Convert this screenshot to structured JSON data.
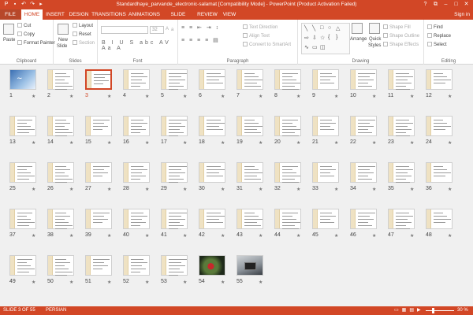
{
  "window": {
    "title": "Standardhaye_parvande_electronic-salamat [Compatibility Mode] - PowerPoint (Product Activation Failed)",
    "qat_icons": [
      "powerpoint-icon",
      "save-icon",
      "undo-icon",
      "redo-icon",
      "present-icon"
    ],
    "controls": {
      "help": "?",
      "restore": "⧉",
      "minimize": "–",
      "maximize": "□",
      "close": "✕"
    }
  },
  "tabs": {
    "file": "FILE",
    "home": "HOME",
    "insert": "INSERT",
    "design": "DESIGN",
    "transitions": "TRANSITIONS",
    "animations": "ANIMATIONS",
    "slideshow": "SLIDE SHOW",
    "review": "REVIEW",
    "view": "VIEW",
    "signin": "Sign in"
  },
  "ribbon": {
    "clipboard": {
      "paste": "Paste",
      "cut": "Cut",
      "copy": "Copy",
      "format_painter": "Format Painter",
      "label": "Clipboard"
    },
    "slides": {
      "new_slide": "New",
      "new_slide2": "Slide",
      "layout": "Layout",
      "reset": "Reset",
      "section": "Section",
      "label": "Slides"
    },
    "font": {
      "name_value": "",
      "size_value": "32",
      "format_buttons": "B I U S abc AV Aa A",
      "label": "Font"
    },
    "paragraph": {
      "text_direction": "Text Direction",
      "align_text": "Align Text",
      "convert_smartart": "Convert to SmartArt",
      "label": "Paragraph"
    },
    "drawing": {
      "arrange": "Arrange",
      "quick": "Quick",
      "styles": "Styles",
      "shape_fill": "Shape Fill",
      "shape_outline": "Shape Outline",
      "shape_effects": "Shape Effects",
      "label": "Drawing"
    },
    "editing": {
      "find": "Find",
      "replace": "Replace",
      "select": "Select",
      "label": "Editing"
    }
  },
  "slides": {
    "selected": 3,
    "numbers": [
      "1",
      "2",
      "3",
      "4",
      "5",
      "6",
      "7",
      "8",
      "9",
      "10",
      "11",
      "12",
      "13",
      "14",
      "15",
      "16",
      "17",
      "18",
      "19",
      "20",
      "21",
      "22",
      "23",
      "24",
      "25",
      "26",
      "27",
      "28",
      "29",
      "30",
      "31",
      "32",
      "33",
      "34",
      "35",
      "36",
      "37",
      "38",
      "39",
      "40",
      "41",
      "42",
      "43",
      "44",
      "45",
      "46",
      "47",
      "48",
      "49",
      "50",
      "51",
      "52",
      "53",
      "54",
      "55"
    ],
    "transition_marker": "★"
  },
  "status": {
    "slide_info": "SLIDE 3 OF 55",
    "language": "PERSIAN",
    "zoom": "30 %",
    "zoom_percent": 30
  },
  "colors": {
    "accent": "#d24726",
    "selection": "#d24726"
  }
}
